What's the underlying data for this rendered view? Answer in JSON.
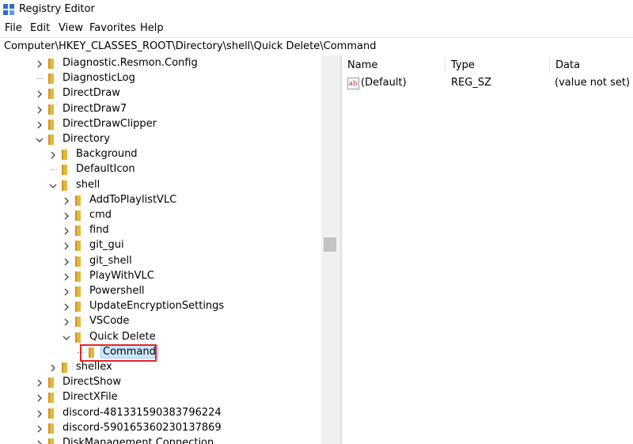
{
  "window": {
    "title": "Registry Editor"
  },
  "menu": [
    "File",
    "Edit",
    "View",
    "Favorites",
    "Help"
  ],
  "address": "Computer\\HKEY_CLASSES_ROOT\\Directory\\shell\\Quick Delete\\Command",
  "tree": [
    {
      "label": "Diagnostic.Resmon.Config",
      "level": 0,
      "expander": "collapsed"
    },
    {
      "label": "DiagnosticLog",
      "level": 0,
      "expander": "none"
    },
    {
      "label": "DirectDraw",
      "level": 0,
      "expander": "collapsed"
    },
    {
      "label": "DirectDraw7",
      "level": 0,
      "expander": "collapsed"
    },
    {
      "label": "DirectDrawClipper",
      "level": 0,
      "expander": "collapsed"
    },
    {
      "label": "Directory",
      "level": 0,
      "expander": "expanded"
    },
    {
      "label": "Background",
      "level": 1,
      "expander": "collapsed"
    },
    {
      "label": "DefaultIcon",
      "level": 1,
      "expander": "none"
    },
    {
      "label": "shell",
      "level": 1,
      "expander": "expanded"
    },
    {
      "label": "AddToPlaylistVLC",
      "level": 2,
      "expander": "collapsed"
    },
    {
      "label": "cmd",
      "level": 2,
      "expander": "collapsed"
    },
    {
      "label": "find",
      "level": 2,
      "expander": "collapsed"
    },
    {
      "label": "git_gui",
      "level": 2,
      "expander": "collapsed"
    },
    {
      "label": "git_shell",
      "level": 2,
      "expander": "collapsed"
    },
    {
      "label": "PlayWithVLC",
      "level": 2,
      "expander": "collapsed"
    },
    {
      "label": "Powershell",
      "level": 2,
      "expander": "collapsed"
    },
    {
      "label": "UpdateEncryptionSettings",
      "level": 2,
      "expander": "collapsed"
    },
    {
      "label": "VSCode",
      "level": 2,
      "expander": "collapsed"
    },
    {
      "label": "Quick Delete",
      "level": 2,
      "expander": "expanded"
    },
    {
      "label": "Command",
      "level": 3,
      "expander": "none",
      "selected": true
    },
    {
      "label": "shellex",
      "level": 1,
      "expander": "collapsed"
    },
    {
      "label": "DirectShow",
      "level": 0,
      "expander": "collapsed"
    },
    {
      "label": "DirectXFile",
      "level": 0,
      "expander": "collapsed"
    },
    {
      "label": "discord-481331590383796224",
      "level": 0,
      "expander": "collapsed"
    },
    {
      "label": "discord-590165360230137869",
      "level": 0,
      "expander": "collapsed"
    },
    {
      "label": "DiskManagement.Connection",
      "level": 0,
      "expander": "collapsed"
    }
  ],
  "columns": {
    "name": "Name",
    "type": "Type",
    "data": "Data"
  },
  "values": [
    {
      "name": "(Default)",
      "type": "REG_SZ",
      "data": "(value not set)",
      "icon": "string-value-icon"
    }
  ],
  "colors": {
    "highlight_border": "#e1252b",
    "folder": "#e8b73a",
    "selection": "#cce8ff"
  }
}
